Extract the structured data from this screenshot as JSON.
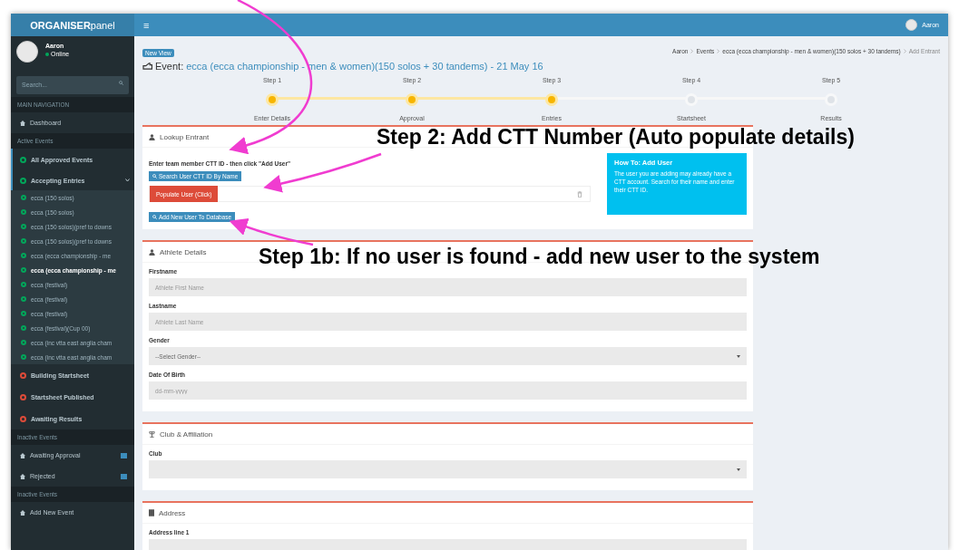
{
  "app": {
    "logo_bold": "ORGANISER",
    "logo_light": "panel",
    "menu_glyph": "≡",
    "user_name": "Aaron"
  },
  "sidebar": {
    "user": {
      "name": "Aaron",
      "status": "Online"
    },
    "search": {
      "placeholder": "Search..."
    },
    "items": [
      {
        "kind": "header",
        "label": "MAIN NAVIGATION"
      },
      {
        "kind": "link",
        "label": "Dashboard"
      },
      {
        "kind": "header",
        "label": "Active Events"
      },
      {
        "kind": "status",
        "label": "All Approved Events",
        "color": "#00a65a"
      },
      {
        "kind": "group",
        "label": "Accepting Entries",
        "color": "#00a65a",
        "expanded": true,
        "children": [
          {
            "label": "ecca (150 solos)",
            "selected": false
          },
          {
            "label": "ecca (150 solos)",
            "selected": false
          },
          {
            "label": "ecca (150 solos)(pref to downs",
            "selected": false
          },
          {
            "label": "ecca (150 solos)(pref to downs",
            "selected": false
          },
          {
            "label": "ecca (ecca championship - me",
            "selected": false
          },
          {
            "label": "ecca (ecca championship - me",
            "selected": true
          },
          {
            "label": "ecca (festival)",
            "selected": false
          },
          {
            "label": "ecca (festival)",
            "selected": false
          },
          {
            "label": "ecca (festival)",
            "selected": false
          },
          {
            "label": "ecca (festival)(Cup 00)",
            "selected": false
          },
          {
            "label": "ecca (inc vtta east anglia cham",
            "selected": false
          },
          {
            "label": "ecca (inc vtta east anglia cham",
            "selected": false
          }
        ]
      },
      {
        "kind": "status",
        "label": "Building Startsheet",
        "color": "#dd4b39"
      },
      {
        "kind": "status",
        "label": "Startsheet Published",
        "color": "#dd4b39"
      },
      {
        "kind": "status",
        "label": "Awaiting Results",
        "color": "#dd4b39"
      },
      {
        "kind": "header",
        "label": "Inactive Events"
      },
      {
        "kind": "link",
        "label": "Awaiting Approval",
        "badge": true
      },
      {
        "kind": "link",
        "label": "Rejected",
        "badge": true
      },
      {
        "kind": "header",
        "label": "Inactive Events"
      },
      {
        "kind": "link",
        "label": "Add New Event"
      }
    ]
  },
  "page": {
    "badge": "New View",
    "title_prefix": "Event:",
    "title": "ecca (ecca championship - men & women)(150 solos + 30 tandems) - 21 May 16",
    "breadcrumb": [
      "Aaron",
      "Events",
      "ecca (ecca championship - men & women)(150 solos + 30 tandems)",
      "Add Entrant"
    ]
  },
  "steps": [
    {
      "step": "Step 1",
      "label": "Enter Details",
      "done": true
    },
    {
      "step": "Step 2",
      "label": "Approval",
      "done": true
    },
    {
      "step": "Step 3",
      "label": "Entries",
      "done": true
    },
    {
      "step": "Step 4",
      "label": "Startsheet",
      "done": false
    },
    {
      "step": "Step 5",
      "label": "Results",
      "done": false
    }
  ],
  "lookup": {
    "title": "Lookup Entrant",
    "hint": "Enter team member CTT ID - then click \"Add User\"",
    "search_button": "Search User CTT ID By Name",
    "populate_button": "Populate User (Click)",
    "add_button": "Add New User To Database",
    "info": {
      "title": "How To: Add User",
      "text": "The user you are adding may already have a CTT account. Search for their name and enter their CTT ID."
    }
  },
  "athlete": {
    "title": "Athlete Details",
    "fields": [
      {
        "kind": "input",
        "label": "Firstname",
        "placeholder": "Athlete First Name"
      },
      {
        "kind": "input",
        "label": "Lastname",
        "placeholder": "Athlete Last Name"
      },
      {
        "kind": "select",
        "label": "Gender",
        "value": "--Select Gender--"
      },
      {
        "kind": "input",
        "label": "Date Of Birth",
        "placeholder": "dd-mm-yyyy"
      }
    ]
  },
  "club": {
    "title": "Club & Affiliation",
    "fields": [
      {
        "kind": "select",
        "label": "Club"
      }
    ]
  },
  "address": {
    "title": "Address",
    "fields": [
      {
        "kind": "input",
        "label": "Address line 1"
      }
    ]
  },
  "annotations": [
    {
      "text": "Step 2: Add CTT Number (Auto populate details)"
    },
    {
      "text": "Step 1b: If no user is found - add new user to the system"
    }
  ]
}
